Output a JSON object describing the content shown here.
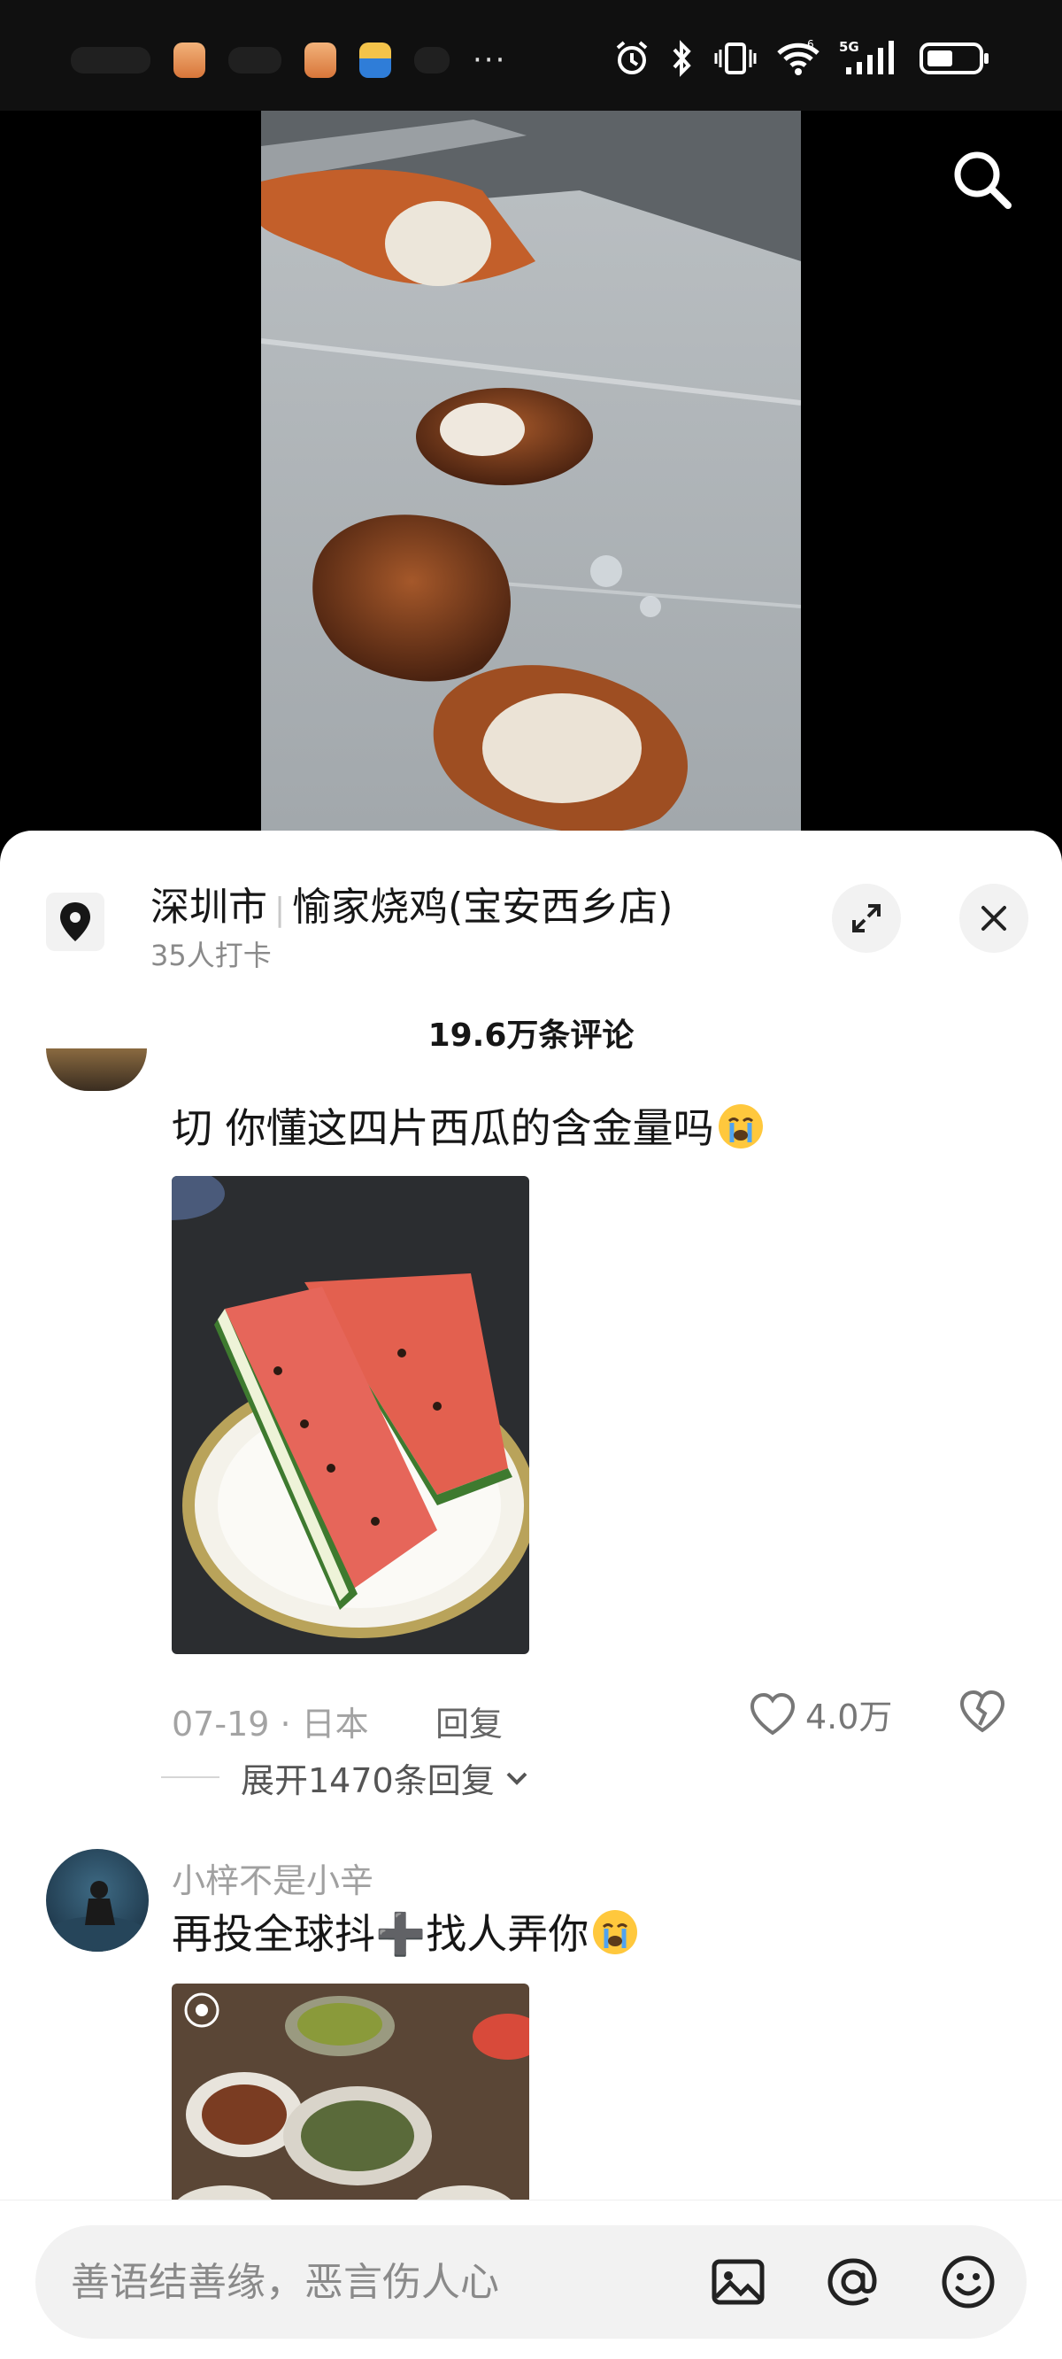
{
  "status_bar": {
    "network": "5G",
    "sim": "6"
  },
  "location": {
    "city": "深圳市",
    "store": "愉家烧鸡(宝安西乡店)",
    "checkins": "35人打卡"
  },
  "comments_header": {
    "count": "19.6万条评论"
  },
  "comments": [
    {
      "text": "切 你懂这四片西瓜的含金量吗",
      "date_location": "07-19 · 日本",
      "reply_label": "回复",
      "likes": "4.0万",
      "expand_label": "展开1470条回复"
    },
    {
      "username": "小梓不是小辛",
      "text": "再投全球抖➕找人弄你"
    }
  ],
  "input": {
    "placeholder": "善语结善缘，恶言伤人心"
  },
  "icons": {
    "search": "search-icon",
    "location": "location-pin-icon",
    "expand": "expand-icon",
    "close": "close-icon",
    "like": "heart-icon",
    "dislike": "broken-heart-icon",
    "image": "image-icon",
    "mention": "at-icon",
    "emoji": "emoji-icon"
  }
}
